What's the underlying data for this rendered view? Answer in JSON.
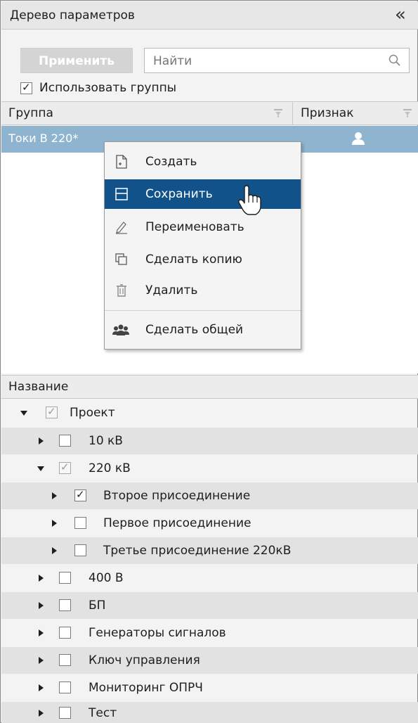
{
  "panel": {
    "title": "Дерево параметров",
    "collapse_glyph": "«"
  },
  "toolbar": {
    "apply_label": "Применить",
    "search_placeholder": "Найти",
    "search_value": ""
  },
  "use_groups": {
    "label": "Использовать группы",
    "checked": true
  },
  "groups_grid": {
    "col_group": "Группа",
    "col_sign": "Признак",
    "rows": [
      {
        "name": "Токи В 220*",
        "sign_icon": "user-icon",
        "selected": true
      }
    ]
  },
  "context_menu": {
    "items": [
      {
        "label": "Создать",
        "icon": "new-document-icon"
      },
      {
        "label": "Сохранить",
        "icon": "save-icon",
        "highlighted": true
      },
      {
        "label": "Переименовать",
        "icon": "rename-pencil-icon"
      },
      {
        "label": "Сделать копию",
        "icon": "copy-icon"
      },
      {
        "label": "Удалить",
        "icon": "trash-icon"
      },
      {
        "label": "Сделать общей",
        "icon": "users-group-icon"
      }
    ]
  },
  "tree": {
    "header": "Название",
    "rows": [
      {
        "label": "Проект",
        "expanded": true,
        "checked": true,
        "grey": true
      },
      {
        "label": "10 кВ",
        "expanded": false,
        "checked": false
      },
      {
        "label": "220 кВ",
        "expanded": true,
        "checked": true,
        "grey": true
      },
      {
        "label": "Второе присоединение",
        "expanded": false,
        "checked": true
      },
      {
        "label": "Первое присоединение",
        "expanded": false,
        "checked": false
      },
      {
        "label": "Третье присоединение 220кВ",
        "expanded": false,
        "checked": false
      },
      {
        "label": "400 В",
        "expanded": false,
        "checked": false
      },
      {
        "label": "БП",
        "expanded": false,
        "checked": false
      },
      {
        "label": "Генераторы сигналов",
        "expanded": false,
        "checked": false
      },
      {
        "label": "Ключ управления",
        "expanded": false,
        "checked": false
      },
      {
        "label": "Мониторинг ОПРЧ",
        "expanded": false,
        "checked": false
      },
      {
        "label": "Тест",
        "expanded": false,
        "checked": false
      }
    ]
  },
  "colors": {
    "selected_row": "#8eb4cf",
    "menu_highlight": "#105289",
    "apply_disabled": "#d4d4d4"
  }
}
